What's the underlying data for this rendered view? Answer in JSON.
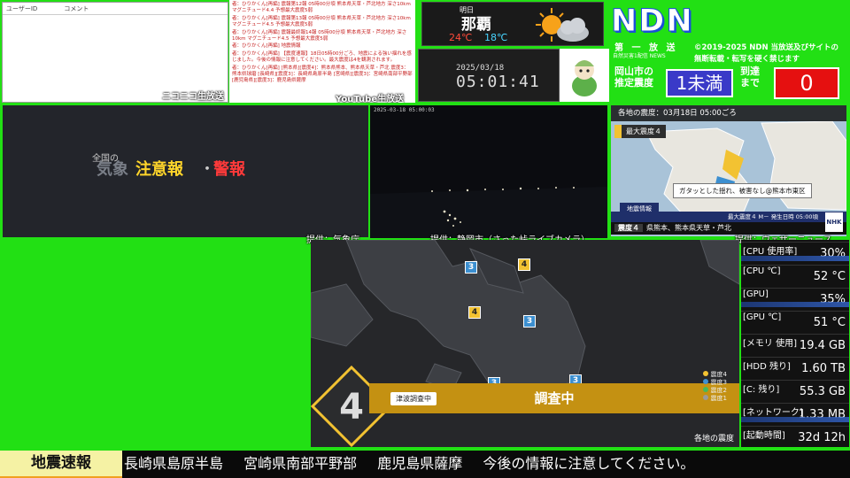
{
  "comments": {
    "col_user": "ユーザーID",
    "col_comment": "コメント",
    "label": "ニコニコ生放送"
  },
  "log": {
    "label": "YouTube生放送",
    "lines": [
      "者：ひりかくん[再編] 震報第12報 05時00分頃 熊本県天草・芦北地方 深さ10km マグニチュード4.4 予想最大震度5弱",
      "者：ひりかくん[再編] 震報第13報 05時00分頃 熊本県天草・芦北地方 深さ10km マグニチュード4.5 予想最大震度5弱",
      "者：ひりかくん[再編] 震報最終報14報 05時00分頃 熊本県天草・芦北地方 深さ10km マグニチュード4.5 予想最大震度5弱",
      "者：ひりかくん[再編] 地震情報",
      "者：ひりかくん[再編] 【震度速報】18日05時00分ごろ、地震による強い揺れを感じました。今後の情報に注意してください。最大震度は4を観測されます。",
      "者：ひりかくん[再編] [熊本県][震度4]：熊本県熊本、熊本県天草・芦北 震度3：熊本県球磨 [長崎県][震度3]：長崎県島原半島 [宮崎県][震度3]：宮崎県南部平野部 [鹿児島県][震度3]：鹿児島県薩摩"
    ]
  },
  "weather": {
    "day": "明日",
    "city": "那覇",
    "high": "24℃",
    "low": "18℃",
    "icon": "sun-cloud-icon"
  },
  "clock": {
    "date": "2025/03/18",
    "time": "05:01:41"
  },
  "ndn": {
    "logo": "NDN",
    "channel": "第 一 放 送",
    "sub": "自然災害1配信 NEWS",
    "copyright_1": "©2019-2025 NDN 当放送及びサイトの",
    "copyright_2": "無断転載・転写を硬く禁じます",
    "est_line1": "岡山市の",
    "est_line2": "推定震度",
    "intensity": "1未満",
    "arrival_line1": "到達",
    "arrival_line2": "まで",
    "countdown": "0",
    "brand_color": "#1b4fd8"
  },
  "broadcast": {
    "line1": "全国の",
    "word_a": "気象",
    "word_b": "注意報",
    "separator": "・",
    "word_c": "警報"
  },
  "camera": {
    "timestamp": "2025-03-18 05:00:03"
  },
  "shindo_map": {
    "header": "各地の震度：03月18日 05:00ごろ",
    "max_label": "最大震度４",
    "note": "ガタッとした揺れ、被害なし@熊本市東区",
    "info_label": "地震情報",
    "info_bar": "最大震度４  M－  発生日時 05:00頃",
    "bottom_tag": "震度４",
    "bottom_text": "県熊本、熊本県天草・芦北",
    "nhk": "NHK"
  },
  "credits": {
    "jma": "提供：気象庁",
    "shizuoka": "提供：静岡市（さった峠ライブカメラ）",
    "weathernews": "提供：ウェザーニュース"
  },
  "main_map": {
    "max_intensity": "4",
    "status": "調査中",
    "tsunami": "津波調査中",
    "caption": "各地の震度",
    "legend": [
      "震度4",
      "震度3",
      "震度2",
      "震度1"
    ],
    "legend_colors": [
      "#f2c232",
      "#3c8fd0",
      "#46b85a",
      "#9a9a9a"
    ],
    "markers": [
      {
        "label": "3",
        "level": 3
      },
      {
        "label": "4",
        "level": 4
      },
      {
        "label": "4",
        "level": 4
      },
      {
        "label": "3",
        "level": 3
      },
      {
        "label": "3",
        "level": 3
      },
      {
        "label": "3",
        "level": 3
      }
    ]
  },
  "stats": [
    {
      "key": "[CPU 使用率]",
      "value": "30%"
    },
    {
      "key": "[CPU ℃]",
      "value": "52 °C"
    },
    {
      "key": "[GPU]",
      "value": "35%"
    },
    {
      "key": "[GPU ℃]",
      "value": "51 °C"
    },
    {
      "key": "[メモリ 使用]",
      "value": "19.4 GB"
    },
    {
      "key": "[HDD 残り]",
      "value": "1.60 TB"
    },
    {
      "key": "[C: 残り]",
      "value": "55.3 GB"
    },
    {
      "key": "[ネットワーク]",
      "value": "1.33 MB"
    },
    {
      "key": "[起動時間]",
      "value": "32d 12h"
    }
  ],
  "ticker": {
    "label": "地震速報",
    "items": [
      "長崎県島原半島",
      "宮崎県南部平野部",
      "鹿児島県薩摩",
      "今後の情報に注意してください。"
    ]
  }
}
